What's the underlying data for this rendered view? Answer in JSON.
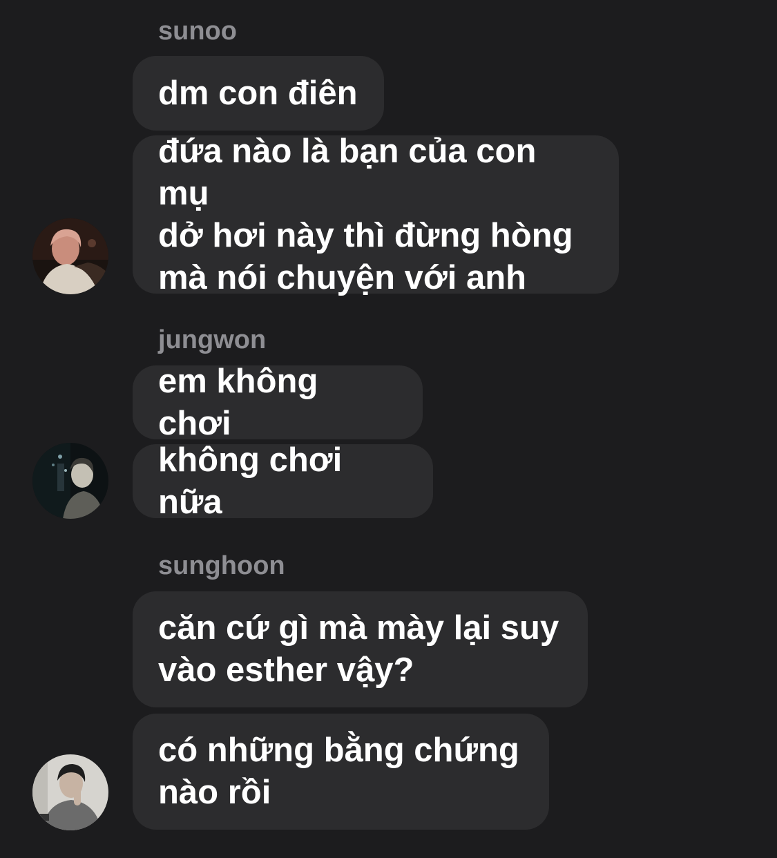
{
  "messages_groups": [
    {
      "sender": "sunoo",
      "messages": [
        "dm con điên",
        "đứa nào là bạn của con mụ\ndở hơi này thì đừng hòng\nmà nói chuyện với anh"
      ]
    },
    {
      "sender": "jungwon",
      "messages": [
        "em không chơi",
        "không chơi nữa"
      ]
    },
    {
      "sender": "sunghoon",
      "messages": [
        "căn cứ gì mà mày lại suy\nvào esther vậy?",
        "có những bằng chứng\nnào rồi"
      ]
    }
  ],
  "colors": {
    "background": "#1c1c1e",
    "bubble": "#2c2c2e",
    "sender_name": "#8e8e93",
    "message_text": "#ffffff"
  },
  "icons": {
    "avatar_1": "user-photo-avatar",
    "avatar_2": "user-photo-avatar",
    "avatar_3": "user-photo-avatar"
  }
}
